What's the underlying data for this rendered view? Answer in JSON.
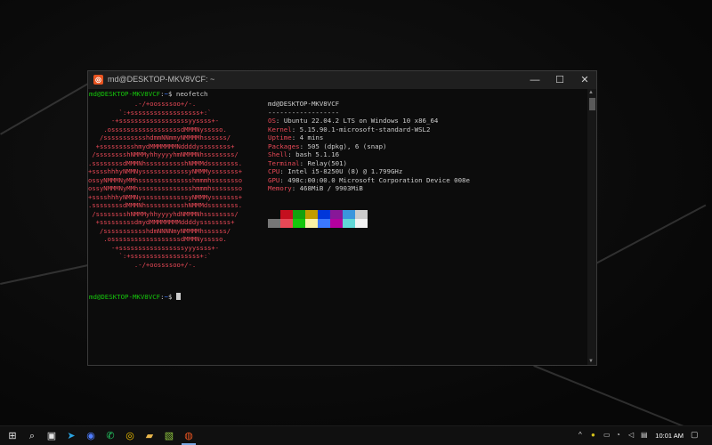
{
  "window": {
    "title": "md@DESKTOP-MKV8VCF: ~",
    "minimize_icon": "minimize-icon",
    "maximize_icon": "maximize-icon",
    "close_icon": "close-icon"
  },
  "terminal": {
    "prompt1": {
      "user": "md@DESKTOP-MKV8VCF",
      "sep": ":",
      "path": "~",
      "sym": "$ ",
      "cmd": "neofetch"
    },
    "logo": [
      "            .-/+oossssoo+/-.",
      "        `:+ssssssssssssssssss+:`",
      "      -+ssssssssssssssssssyyssss+-",
      "    .ossssssssssssssssssdMMMNysssso.",
      "   /ssssssssssshdmmNNmmyNMMMMhssssss/",
      "  +ssssssssshmydMMMMMMMNddddyssssssss+",
      " /sssssssshNMMMyhhyyyyhmNMMMNhssssssss/",
      ".ssssssssdMMMNhsssssssssshNMMMdssssssss.",
      "+sssshhhyNMMNyssssssssssssyNMMMysssssss+",
      "ossyNMMMNyMMhsssssssssssssshmmmhssssssso",
      "ossyNMMMNyMMhsssssssssssssshmmmhssssssso",
      "+sssshhhyNMMNyssssssssssssyNMMMysssssss+",
      ".ssssssssdMMMNhsssssssssshNMMMdssssssss.",
      " /sssssssshNMMMyhhyyyyhdNMMMNhssssssss/",
      "  +sssssssssdmydMMMMMMMMddddyssssssss+",
      "   /ssssssssssshdmNNNNmyNMMMMhssssss/",
      "    .ossssssssssssssssssdMMMNysssso.",
      "      -+sssssssssssssssssyyyssss+-",
      "        `:+ssssssssssssssssss+:`",
      "            .-/+oossssoo+/-."
    ],
    "header": "md@DESKTOP-MKV8VCF",
    "divider": "------------------",
    "info": [
      {
        "key": "OS",
        "value": "Ubuntu 22.04.2 LTS on Windows 10 x86_64"
      },
      {
        "key": "Kernel",
        "value": "5.15.90.1-microsoft-standard-WSL2"
      },
      {
        "key": "Uptime",
        "value": "4 mins"
      },
      {
        "key": "Packages",
        "value": "505 (dpkg), 6 (snap)"
      },
      {
        "key": "Shell",
        "value": "bash 5.1.16"
      },
      {
        "key": "Terminal",
        "value": "Relay(501)"
      },
      {
        "key": "CPU",
        "value": "Intel i5-8250U (8) @ 1.799GHz"
      },
      {
        "key": "GPU",
        "value": "498c:00:00.0 Microsoft Corporation Device 008e"
      },
      {
        "key": "Memory",
        "value": "468MiB / 9903MiB"
      }
    ],
    "palette_top": [
      "#0c0c0c",
      "#c50f1f",
      "#13a10e",
      "#c19c00",
      "#0037da",
      "#881798",
      "#3a96dd",
      "#cccccc"
    ],
    "palette_bottom": [
      "#767676",
      "#e74856",
      "#16c60c",
      "#f9f1a5",
      "#3b78ff",
      "#b4009e",
      "#61d6d6",
      "#f2f2f2"
    ],
    "prompt2": {
      "user": "md@DESKTOP-MKV8VCF",
      "sep": ":",
      "path": "~",
      "sym": "$ "
    }
  },
  "taskbar": {
    "icons": [
      "windows-start-icon",
      "search-icon",
      "task-view-icon",
      "telegram-icon",
      "messenger-icon",
      "whatsapp-icon",
      "chrome-icon",
      "file-explorer-icon",
      "sticky-notes-icon",
      "ubuntu-terminal-icon"
    ],
    "tray_chevron": "^",
    "clock": "10:01 AM"
  }
}
